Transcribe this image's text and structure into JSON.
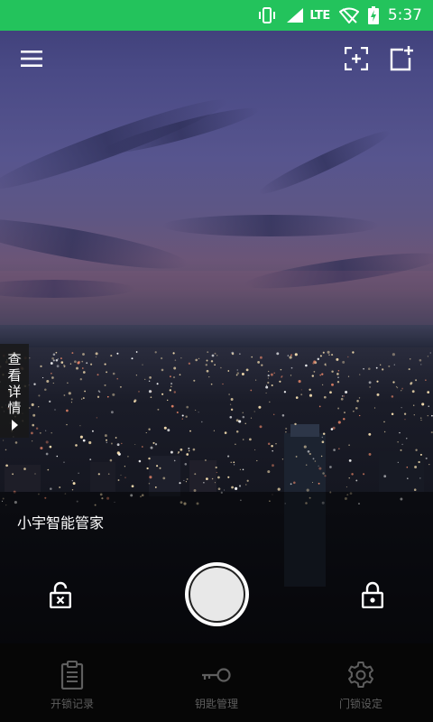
{
  "status_bar": {
    "network": "LTE",
    "time": "5:37"
  },
  "top_bar": {
    "menu_icon": "hamburger-menu-icon",
    "scan_icon": "scan-add-icon",
    "add_icon": "add-device-icon"
  },
  "side_tab": {
    "label": "查看详情"
  },
  "panel": {
    "device_name": "小宇智能管家"
  },
  "bottom_nav": {
    "items": [
      {
        "label": "开锁记录",
        "icon": "clipboard-icon"
      },
      {
        "label": "钥匙管理",
        "icon": "key-icon"
      },
      {
        "label": "门锁设定",
        "icon": "gear-icon"
      }
    ]
  },
  "colors": {
    "status_bar": "#23c35c",
    "nav_background": "#060606",
    "nav_label": "#5e5e5e"
  }
}
